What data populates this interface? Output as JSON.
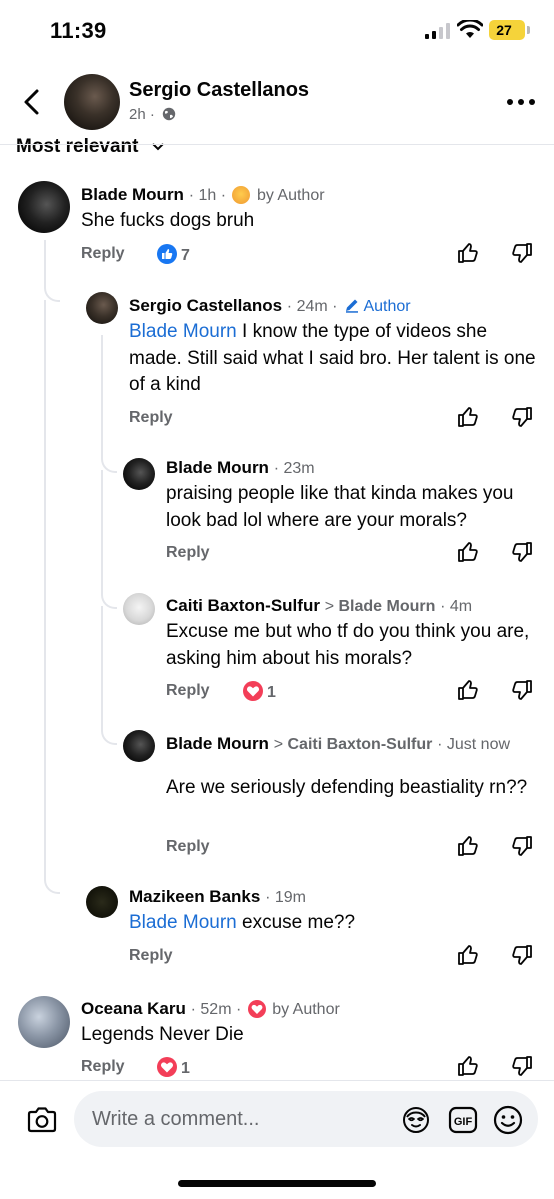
{
  "status_bar": {
    "time": "11:39",
    "battery": "27"
  },
  "header": {
    "name": "Sergio Castellanos",
    "time": "2h"
  },
  "sort": {
    "label": "Most relevant"
  },
  "comments": [
    {
      "name": "Blade Mourn",
      "time": "1h",
      "badge": "by Author",
      "text": "She fucks dogs bruh",
      "reply": "Reply",
      "reaction_count": "7"
    },
    {
      "name": "Sergio Castellanos",
      "time": "24m",
      "badge": "Author",
      "mention": "Blade Mourn",
      "text": " I know the type of videos she made. Still said what I said bro. Her talent is one of a kind",
      "reply": "Reply"
    },
    {
      "name": "Blade Mourn",
      "time": "23m",
      "text": "praising people like that kinda makes you look bad lol where are your morals?",
      "reply": "Reply"
    },
    {
      "name": "Caiti Baxton-Sulfur",
      "reply_to": "Blade Mourn",
      "time": "4m",
      "text": "Excuse me but who tf do you think you are, asking him about his morals?",
      "reply": "Reply",
      "reaction_count": "1"
    },
    {
      "name": "Blade Mourn",
      "reply_to": "Caiti Baxton-Sulfur",
      "time": "Just now",
      "text": "Are we seriously defending beastiality rn??",
      "reply": "Reply"
    },
    {
      "name": "Mazikeen Banks",
      "time": "19m",
      "mention": "Blade Mourn",
      "text": " excuse me??",
      "reply": "Reply"
    },
    {
      "name": "Oceana Karu",
      "time": "52m",
      "badge": "by Author",
      "text": "Legends Never Die",
      "reply": "Reply",
      "reaction_count": "1"
    }
  ],
  "composer": {
    "placeholder": "Write a comment..."
  },
  "colors": {
    "accent": "#1b6dd4",
    "like": "#1877f2",
    "love": "#f33e58",
    "muted": "#65676b",
    "battery": "#f5d33a"
  },
  "icons": [
    "back-arrow-icon",
    "globe-icon",
    "more-icon",
    "chevron-down-icon",
    "like-icon",
    "love-icon",
    "pencil-icon",
    "thumbs-up-icon",
    "thumbs-down-icon",
    "camera-icon",
    "avatar-sticker-icon",
    "gif-icon",
    "emoji-icon"
  ]
}
